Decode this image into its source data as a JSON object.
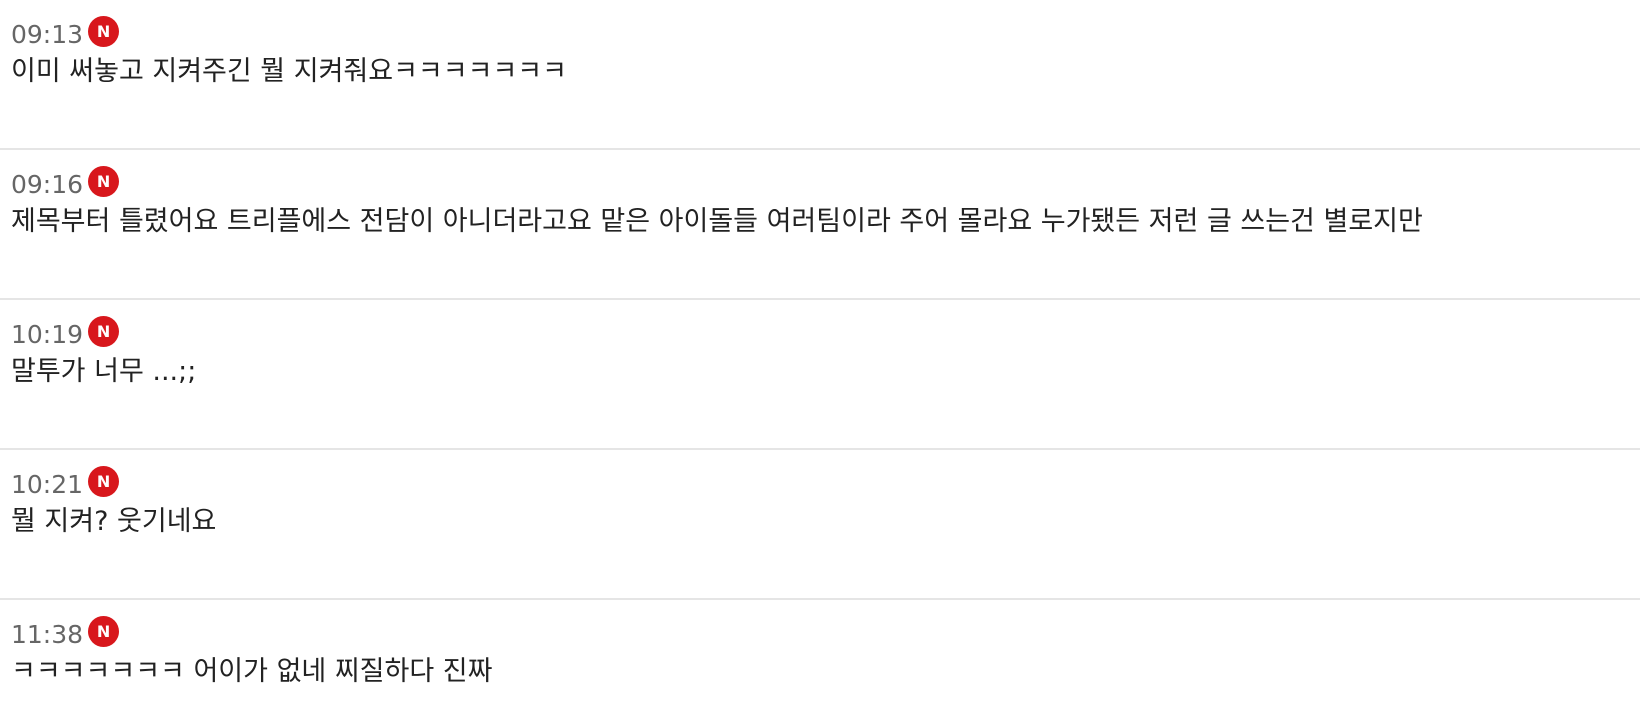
{
  "badge_color": "#d8171c",
  "comments": [
    {
      "time": "09:13",
      "badge": "N",
      "text": "이미 써놓고 지켜주긴 뭘 지켜줘요ㅋㅋㅋㅋㅋㅋㅋ"
    },
    {
      "time": "09:16",
      "badge": "N",
      "text": "제목부터 틀렸어요 트리플에스 전담이 아니더라고요 맡은 아이돌들 여러팀이라 주어 몰라요 누가됐든 저런 글 쓰는건 별로지만"
    },
    {
      "time": "10:19",
      "badge": "N",
      "text": "말투가 너무 ...;;"
    },
    {
      "time": "10:21",
      "badge": "N",
      "text": "뭘 지켜? 웃기네요"
    },
    {
      "time": "11:38",
      "badge": "N",
      "text": "ㅋㅋㅋㅋㅋㅋㅋ 어이가 없네 찌질하다 진짜"
    }
  ]
}
